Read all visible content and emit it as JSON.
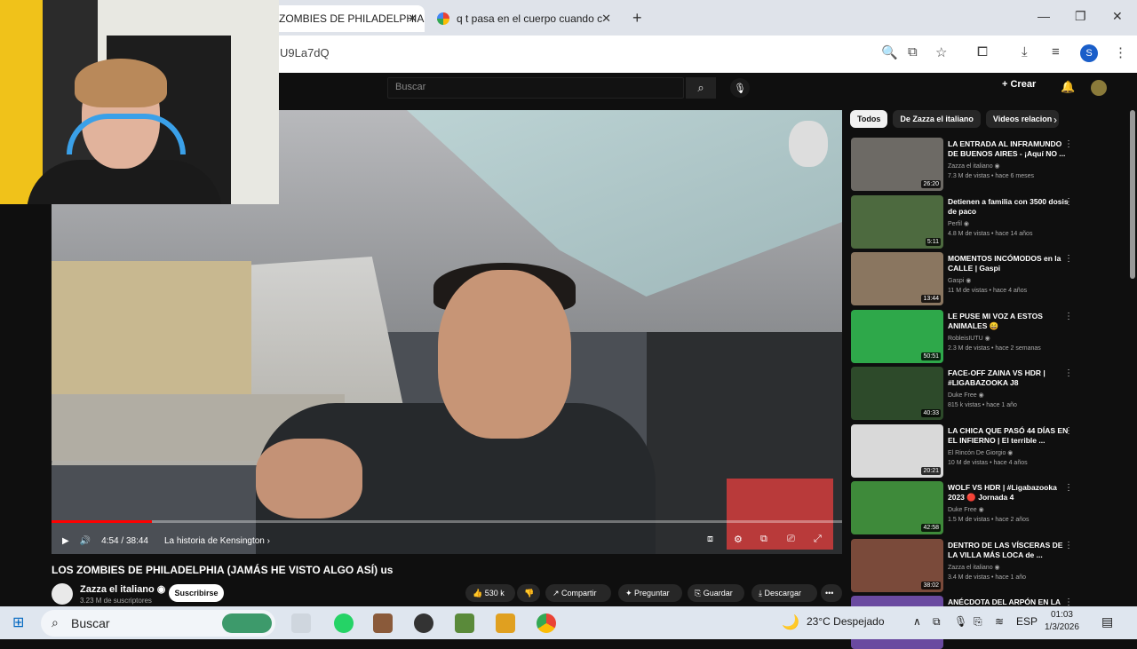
{
  "browser": {
    "tabs": [
      {
        "label": "ZOMBIES DE PHILADELPHIA",
        "close": "✕"
      },
      {
        "label": "q t pasa en el cuerpo cuando c",
        "close": "✕"
      }
    ],
    "new_tab": "+",
    "url": "U9La7dQ",
    "profile_initial": "S",
    "window_controls": [
      "—",
      "❐",
      "✕"
    ]
  },
  "youtube_header": {
    "search_placeholder": "Buscar",
    "create_label": "+ Crear"
  },
  "player": {
    "time": "4:54 / 38:44",
    "chapter": "La historia de Kensington ›",
    "progress_fraction": 0.127
  },
  "video": {
    "title": "LOS ZOMBIES DE PHILADELPHIA (JAMÁS HE VISTO ALGO ASÍ) us",
    "channel": "Zazza el italiano ◉",
    "subscribers": "3.23 M de suscriptores",
    "subscribe": "Suscribirse",
    "likes": "530 k",
    "share": "Compartir",
    "ask": "Preguntar",
    "save": "Guardar",
    "download": "Descargar",
    "more": "•••"
  },
  "chips": [
    "Todos",
    "De Zazza el italiano",
    "Videos relacion"
  ],
  "recommendations": [
    {
      "title": "LA ENTRADA AL INFRAMUNDO DE BUENOS AIRES - ¡Aquí NO ...",
      "channel": "Zazza el italiano ◉",
      "meta": "7.3 M de vistas • hace 6 meses",
      "duration": "26:20",
      "color": "#6d6a65"
    },
    {
      "title": "Detienen a familia con 3500 dosis de paco",
      "channel": "Perfil ◉",
      "meta": "4.8 M de vistas • hace 14 años",
      "duration": "5:11",
      "color": "#4d6a3f"
    },
    {
      "title": "MOMENTOS INCÓMODOS en la CALLE | Gaspi",
      "channel": "Gaspi ◉",
      "meta": "11 M de vistas • hace 4 años",
      "duration": "13:44",
      "color": "#8a7660"
    },
    {
      "title": "LE PUSE MI VOZ A ESTOS ANIMALES 😄",
      "channel": "RobleisIUTU ◉",
      "meta": "2.3 M de vistas • hace 2 semanas",
      "duration": "50:51",
      "color": "#2ea84a"
    },
    {
      "title": "FACE-OFF ZAINA VS HDR | #LIGABAZOOKA J8",
      "channel": "Duke Free ◉",
      "meta": "815 k vistas • hace 1 año",
      "duration": "40:33",
      "color": "#2d4a2a"
    },
    {
      "title": "LA CHICA QUE PASÓ 44 DÍAS EN EL INFIERNO | El terrible ...",
      "channel": "El Rincón De Giorgio ◉",
      "meta": "10 M de vistas • hace 4 años",
      "duration": "20:21",
      "color": "#d9d9d9"
    },
    {
      "title": "WOLF VS HDR | #Ligabazooka 2023 🔴 Jornada 4",
      "channel": "Duke Free ◉",
      "meta": "1.5 M de vistas • hace 2 años",
      "duration": "42:58",
      "color": "#3e8a3a"
    },
    {
      "title": "DENTRO DE LAS VÍSCERAS DE LA VILLA MÁS LOCA de ...",
      "channel": "Zazza el italiano ◉",
      "meta": "3.4 M de vistas • hace 1 año",
      "duration": "38:02",
      "color": "#7a4a3a"
    },
    {
      "title": "ANÉCDOTA DEL ARPÓN EN LA",
      "channel": "",
      "meta": "",
      "duration": "",
      "color": "#6a4aa0"
    }
  ],
  "taskbar": {
    "search": "Buscar",
    "weather": "23°C Despejado",
    "lang": "ESP",
    "time": "01:03",
    "date": "1/3/2026"
  }
}
